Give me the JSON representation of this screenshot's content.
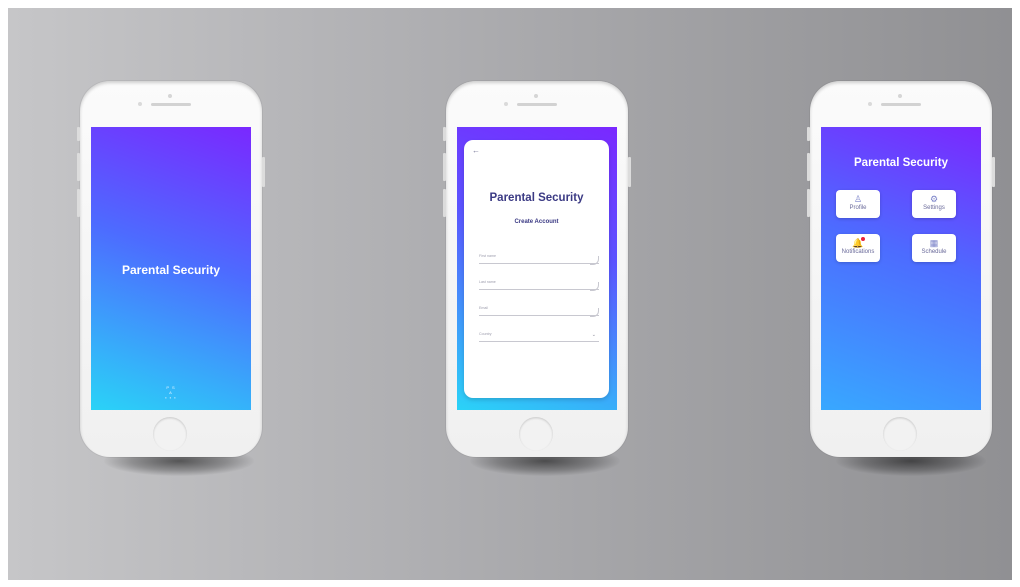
{
  "phone1": {
    "title": "Parental Security",
    "logo_line1": "P S A",
    "logo_line2": "▪ ▪ ▪"
  },
  "phone2": {
    "back_icon": "arrow-left-icon",
    "back_glyph": "←",
    "title": "Parental Security",
    "subtitle": "Create Account",
    "fields": [
      {
        "placeholder": "First name"
      },
      {
        "placeholder": "Last name"
      },
      {
        "placeholder": "Email"
      },
      {
        "placeholder": "Country",
        "has_chevron": true
      }
    ],
    "chevron_glyph": "⌄"
  },
  "phone3": {
    "title": "Parental Security",
    "tiles": [
      {
        "label": "Profile",
        "icon": "user-icon",
        "glyph": "♙"
      },
      {
        "label": "Settings",
        "icon": "gear-icon",
        "glyph": "⚙"
      },
      {
        "label": "Notifications",
        "icon": "bell-icon",
        "glyph": "🔔"
      },
      {
        "label": "Schedule",
        "icon": "calendar-icon",
        "glyph": "▦"
      }
    ]
  },
  "colors": {
    "gradient_top": "#7a28ff",
    "gradient_mid": "#4d6bff",
    "gradient_bottom": "#2ad3f7",
    "title_dark": "#3b3a84",
    "notification_dot": "#e8203a"
  }
}
